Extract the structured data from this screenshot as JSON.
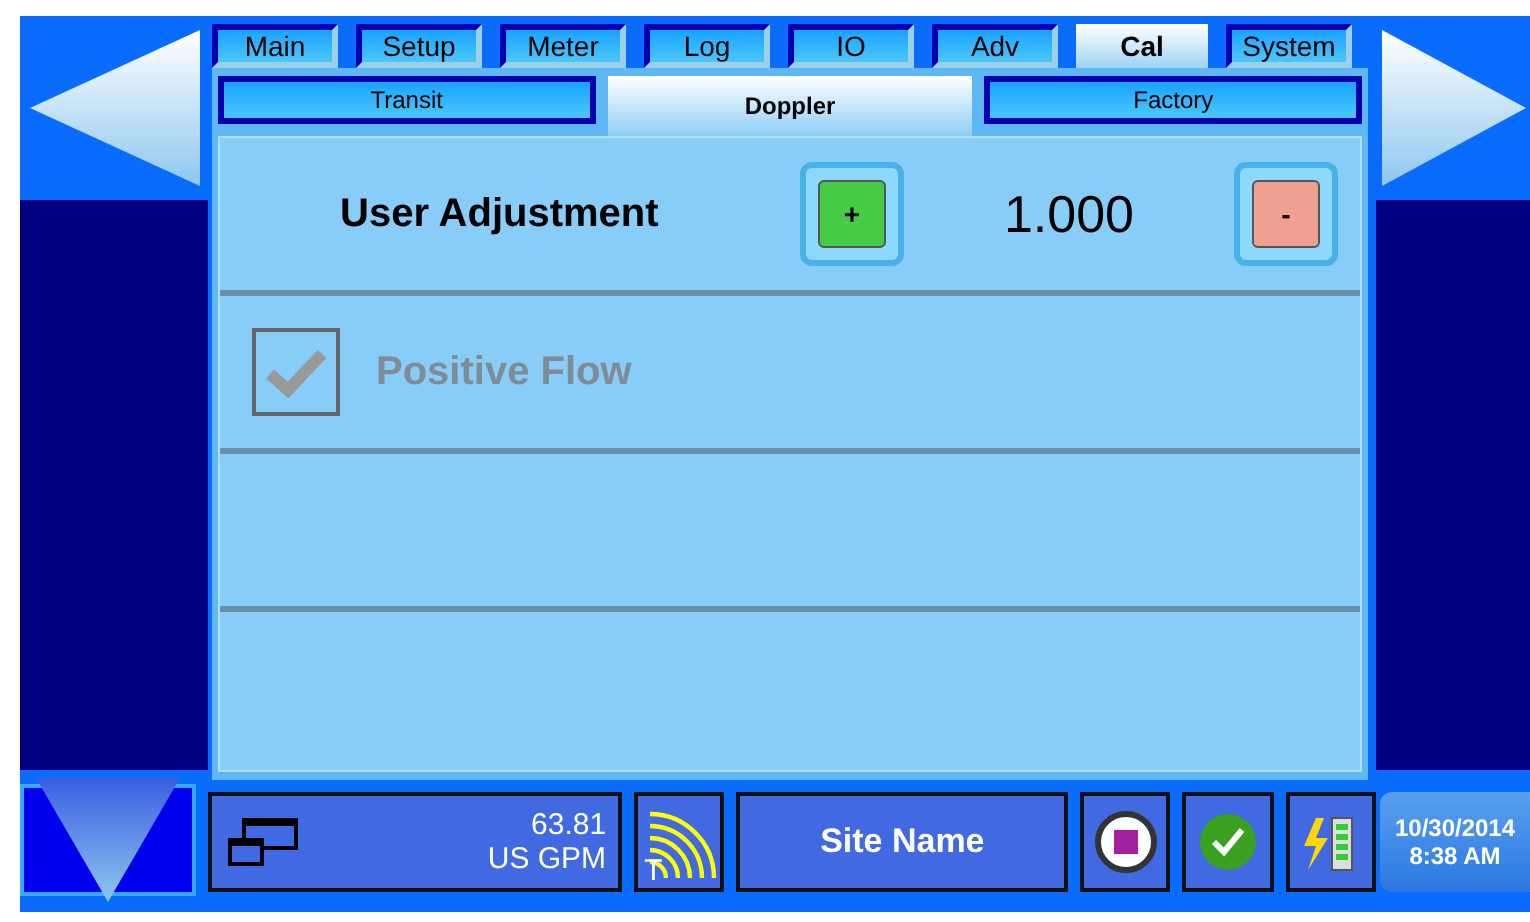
{
  "tabs": [
    {
      "label": "Main",
      "selected": false
    },
    {
      "label": "Setup",
      "selected": false
    },
    {
      "label": "Meter",
      "selected": false
    },
    {
      "label": "Log",
      "selected": false
    },
    {
      "label": "IO",
      "selected": false
    },
    {
      "label": "Adv",
      "selected": false
    },
    {
      "label": "Cal",
      "selected": true
    },
    {
      "label": "System",
      "selected": false
    }
  ],
  "subtabs": [
    {
      "label": "Transit",
      "selected": false
    },
    {
      "label": "Doppler",
      "selected": true
    },
    {
      "label": "Factory",
      "selected": false
    }
  ],
  "adjustment": {
    "label": "User Adjustment",
    "plus": "+",
    "value": "1.000",
    "minus": "-"
  },
  "option": {
    "label": "Positive Flow",
    "checked": true,
    "disabled": true
  },
  "status_bar": {
    "reading": "63.81",
    "unit": "US GPM",
    "signal_label": "T",
    "site_name": "Site Name",
    "date": "10/30/2014",
    "time": "8:38 AM"
  }
}
